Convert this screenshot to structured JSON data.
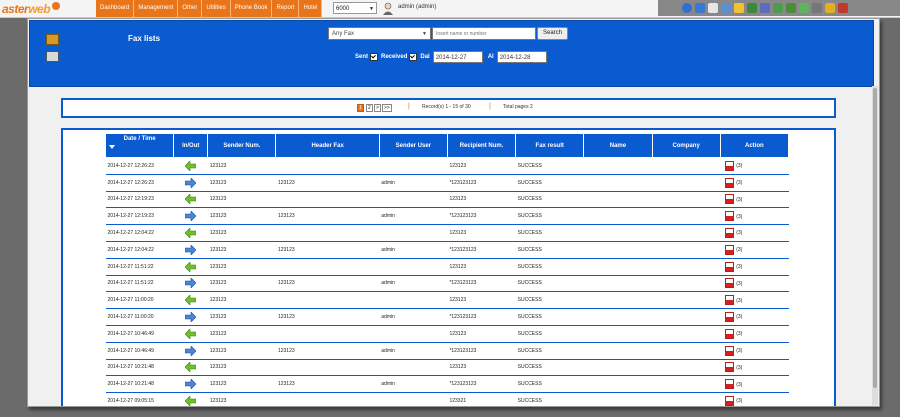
{
  "app": {
    "logo_part1": "aster",
    "logo_part2": "web",
    "menu": [
      "Dashboard",
      "Management",
      "Other",
      "Utilities",
      "Phone Book",
      "Report",
      "Hotel"
    ],
    "extension": "6000",
    "user_label": "admin (admin)"
  },
  "filters": {
    "title": "Fax lists",
    "fax_type": "Any Fax",
    "search_placeholder": "Insert name or number",
    "search_button": "Search",
    "sent_label": "Sent",
    "received_label": "Received",
    "from_label": "Dal",
    "from_date": "2014-12-27",
    "to_label": "Al",
    "to_date": "2014-12-28"
  },
  "pager": {
    "page1": "1",
    "page2": "2",
    "next": ">",
    "last": ">>",
    "records": "Record(s) 1 - 15 of 30",
    "total": "Total pages 2"
  },
  "table": {
    "headers": [
      "Date / Time",
      "In/Out",
      "Sender Num.",
      "Header Fax",
      "Sender User",
      "Recipient Num.",
      "Fax result",
      "Name",
      "Company",
      "Action"
    ],
    "rows": [
      {
        "date": "2014-12-27 12:26:23",
        "dir": "in",
        "sender": "123123",
        "header": "",
        "user": "",
        "recipient": "123123",
        "result": "SUCCESS",
        "name": "",
        "company": "",
        "pages": "(3)"
      },
      {
        "date": "2014-12-27 12:26:23",
        "dir": "out",
        "sender": "123123",
        "header": "123123",
        "user": "admin",
        "recipient": "*123123123",
        "result": "SUCCESS",
        "name": "",
        "company": "",
        "pages": "(3)"
      },
      {
        "date": "2014-12-27 12:19:23",
        "dir": "in",
        "sender": "123123",
        "header": "",
        "user": "",
        "recipient": "123123",
        "result": "SUCCESS",
        "name": "",
        "company": "",
        "pages": "(3)"
      },
      {
        "date": "2014-12-27 12:19:23",
        "dir": "out",
        "sender": "123123",
        "header": "123123",
        "user": "admin",
        "recipient": "*123123123",
        "result": "SUCCESS",
        "name": "",
        "company": "",
        "pages": "(3)"
      },
      {
        "date": "2014-12-27 12:04:22",
        "dir": "in",
        "sender": "123123",
        "header": "",
        "user": "",
        "recipient": "123123",
        "result": "SUCCESS",
        "name": "",
        "company": "",
        "pages": "(3)"
      },
      {
        "date": "2014-12-27 12:04:22",
        "dir": "out",
        "sender": "123123",
        "header": "123123",
        "user": "admin",
        "recipient": "*123123123",
        "result": "SUCCESS",
        "name": "",
        "company": "",
        "pages": "(3)"
      },
      {
        "date": "2014-12-27 11:51:22",
        "dir": "in",
        "sender": "123123",
        "header": "",
        "user": "",
        "recipient": "123123",
        "result": "SUCCESS",
        "name": "",
        "company": "",
        "pages": "(3)"
      },
      {
        "date": "2014-12-27 11:51:22",
        "dir": "out",
        "sender": "123123",
        "header": "123123",
        "user": "admin",
        "recipient": "*123123123",
        "result": "SUCCESS",
        "name": "",
        "company": "",
        "pages": "(3)"
      },
      {
        "date": "2014-12-27 11:00:20",
        "dir": "in",
        "sender": "123123",
        "header": "",
        "user": "",
        "recipient": "123123",
        "result": "SUCCESS",
        "name": "",
        "company": "",
        "pages": "(3)"
      },
      {
        "date": "2014-12-27 11:00:20",
        "dir": "out",
        "sender": "123123",
        "header": "123123",
        "user": "admin",
        "recipient": "*123123123",
        "result": "SUCCESS",
        "name": "",
        "company": "",
        "pages": "(3)"
      },
      {
        "date": "2014-12-27 10:46:49",
        "dir": "in",
        "sender": "123123",
        "header": "",
        "user": "",
        "recipient": "123123",
        "result": "SUCCESS",
        "name": "",
        "company": "",
        "pages": "(3)"
      },
      {
        "date": "2014-12-27 10:46:49",
        "dir": "out",
        "sender": "123123",
        "header": "123123",
        "user": "admin",
        "recipient": "*123123123",
        "result": "SUCCESS",
        "name": "",
        "company": "",
        "pages": "(3)"
      },
      {
        "date": "2014-12-27 10:21:48",
        "dir": "in",
        "sender": "123123",
        "header": "",
        "user": "",
        "recipient": "123123",
        "result": "SUCCESS",
        "name": "",
        "company": "",
        "pages": "(3)"
      },
      {
        "date": "2014-12-27 10:21:48",
        "dir": "out",
        "sender": "123123",
        "header": "123123",
        "user": "admin",
        "recipient": "*123123123",
        "result": "SUCCESS",
        "name": "",
        "company": "",
        "pages": "(3)"
      },
      {
        "date": "2014-12-27 09:05:15",
        "dir": "in",
        "sender": "123123",
        "header": "",
        "user": "",
        "recipient": "123321",
        "result": "SUCCESS",
        "name": "",
        "company": "",
        "pages": "(3)"
      }
    ]
  }
}
